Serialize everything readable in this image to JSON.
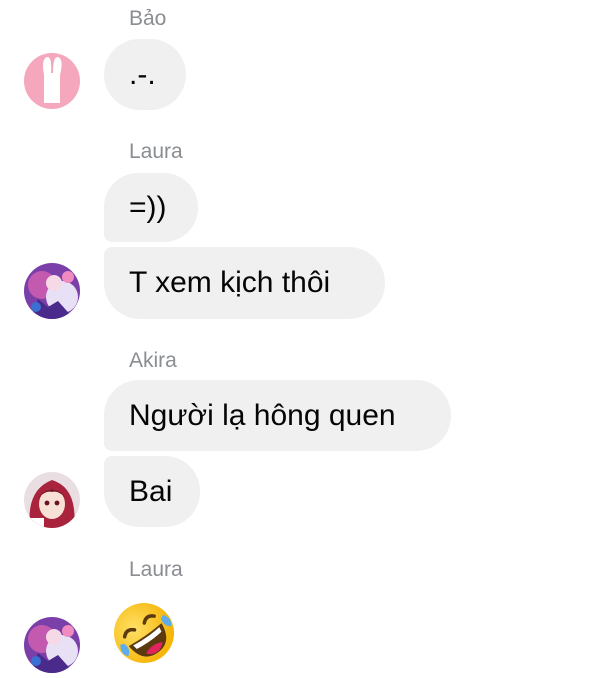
{
  "messages": [
    {
      "sender": "Bảo",
      "text": ".-."
    },
    {
      "sender": "Laura",
      "text": "=))"
    },
    {
      "text": "T xem kịch thôi"
    },
    {
      "sender": "Akira",
      "text": "Người lạ hông quen"
    },
    {
      "text": "Bai"
    },
    {
      "sender": "Laura",
      "emoji": "rolling-on-the-floor-laughing"
    }
  ],
  "colors": {
    "bubble": "#f0f0f0",
    "sender_name": "#8a8d91",
    "text": "#050505"
  }
}
